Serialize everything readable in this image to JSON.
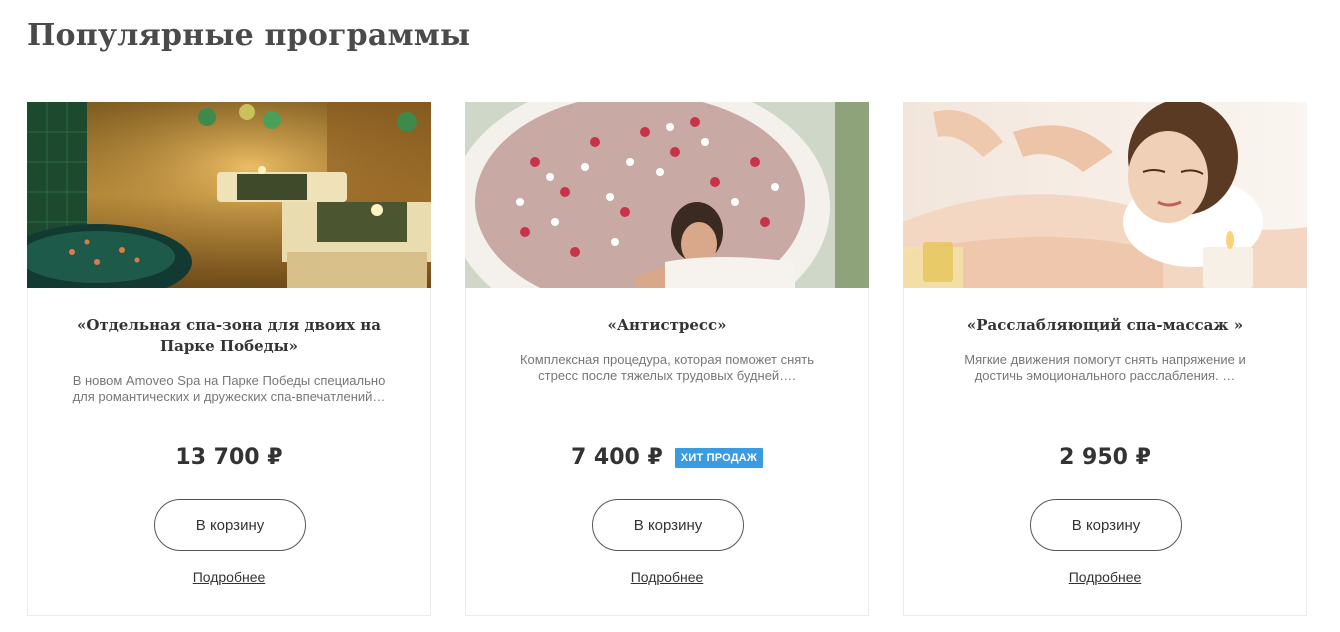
{
  "section": {
    "title": "Популярные программы"
  },
  "cards": [
    {
      "title": "«Отдельная спа-зона для двоих на Парке Победы»",
      "description": "В новом Amoveo Spa на Парке Победы специально для романтических и дружеских спа-впечатлений…",
      "price": "13 700 ₽",
      "badge": "",
      "cart_label": "В корзину",
      "more_label": "Подробнее"
    },
    {
      "title": "«Антистресс»",
      "description": "Комплексная процедура, которая поможет снять стресс после тяжелых трудовых будней….",
      "price": "7 400 ₽",
      "badge": "ХИТ ПРОДАЖ",
      "cart_label": "В корзину",
      "more_label": "Подробнее"
    },
    {
      "title": "«Расслабляющий спа-массаж »",
      "description": "Мягкие движения помогут снять напряжение и достичь эмоционального расслабления. …",
      "price": "2 950 ₽",
      "badge": "",
      "cart_label": "В корзину",
      "more_label": "Подробнее"
    }
  ],
  "colors": {
    "badge": "#3b9be0",
    "title": "#4a4a4a",
    "text_muted": "#777777"
  }
}
